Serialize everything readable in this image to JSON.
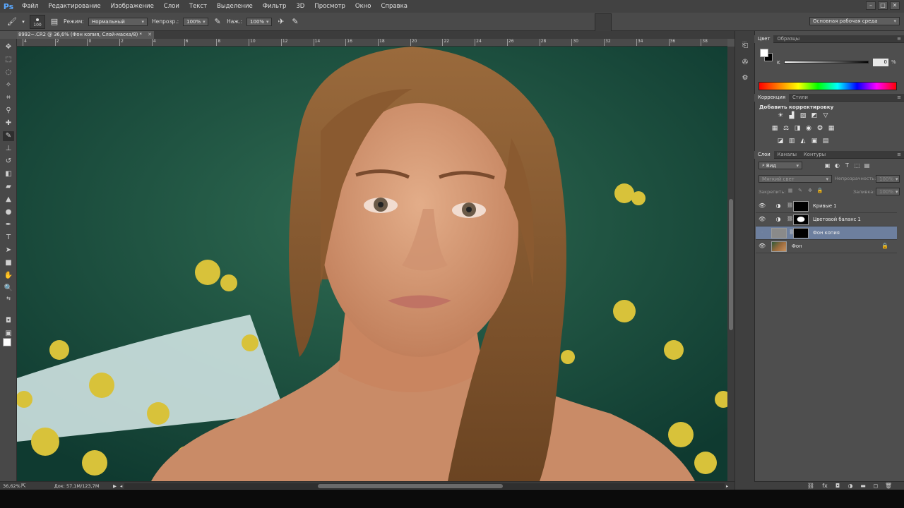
{
  "app": {
    "logo": "Ps",
    "menu": [
      "Файл",
      "Редактирование",
      "Изображение",
      "Слои",
      "Текст",
      "Выделение",
      "Фильтр",
      "3D",
      "Просмотр",
      "Окно",
      "Справка"
    ],
    "window_controls": [
      "–",
      "□",
      "✕"
    ]
  },
  "options_bar": {
    "brush_size": "100",
    "mode_label": "Режим:",
    "mode_value": "Нормальный",
    "opacity_label": "Непрозр.:",
    "opacity_value": "100%",
    "pressure_label": "Наж.:",
    "pressure_value": "100%",
    "workspace": "Основная рабочая среда"
  },
  "document": {
    "tab_title": "8992~.CR2 @ 36,6% (Фон копия, Слой-маска/8) *",
    "zoom": "36,62%",
    "doc_info": "Док: 57,1M/123,7M"
  },
  "rulers": {
    "top_labels": [
      "4",
      "2",
      "0",
      "2",
      "4",
      "6",
      "8",
      "10",
      "12",
      "14",
      "16",
      "18",
      "20",
      "22",
      "24",
      "26",
      "28",
      "30",
      "32",
      "34",
      "36",
      "38"
    ],
    "left_labels": [
      "0",
      "2",
      "4",
      "6",
      "8"
    ]
  },
  "color_panel": {
    "tabs": [
      "Цвет",
      "Образцы"
    ],
    "channel_label": "K",
    "channel_value": "0",
    "unit": "%"
  },
  "adjustments_panel": {
    "tabs": [
      "Коррекция",
      "Стили"
    ],
    "title": "Добавить корректировку"
  },
  "layers_panel": {
    "tabs": [
      "Слои",
      "Каналы",
      "Контуры"
    ],
    "filter_label": "Вид",
    "blend_mode": "Мягкий свет",
    "opacity_label": "Непрозрачность:",
    "opacity_value": "100%",
    "lock_label": "Закрепить:",
    "fill_label": "Заливка:",
    "fill_value": "100%",
    "layers": [
      {
        "name": "Кривые 1",
        "visible": true,
        "selected": false
      },
      {
        "name": "Цветовой баланс 1",
        "visible": true,
        "selected": false
      },
      {
        "name": "Фон копия",
        "visible": false,
        "selected": true
      },
      {
        "name": "Фон",
        "visible": true,
        "selected": false
      }
    ]
  },
  "colors": {
    "accent_selected_layer": "#6d7f9e",
    "foreground": "#ffffff",
    "background": "#000000"
  }
}
